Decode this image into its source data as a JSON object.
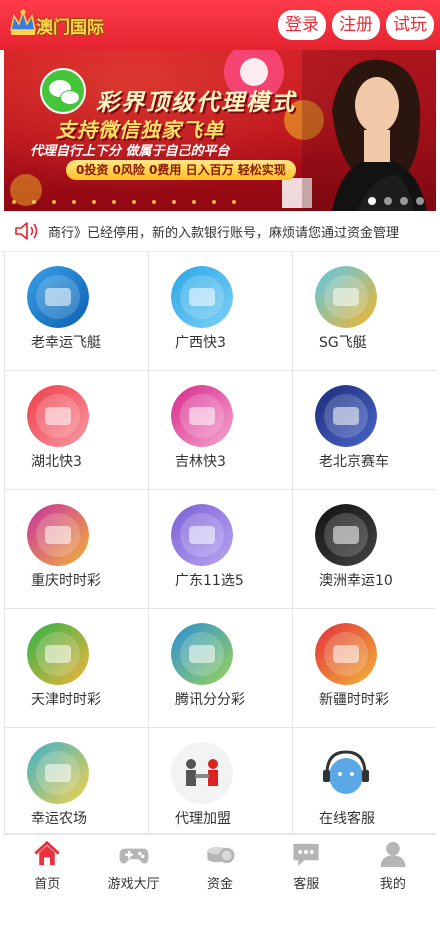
{
  "header": {
    "logo_text": "澳门国际",
    "auth_buttons": [
      "登录",
      "注册",
      "试玩"
    ]
  },
  "banner": {
    "line1": "彩界顶级代理模式",
    "line2": "支持微信独家飞单",
    "line3": "代理自行上下分 做属于自己的平台",
    "pill": "0投资 0风险 0费用 日入百万 轻松实现",
    "slide_count": 4,
    "active_slide": 1
  },
  "notice": {
    "icon": "speaker-icon",
    "text": "商行》已经停用，新的入款银行账号，麻烦请您通过资金管理"
  },
  "games": [
    {
      "label": "老幸运飞艇",
      "icon": "boat-icon",
      "colors": [
        "#3aa0e8",
        "#0b5fb0"
      ]
    },
    {
      "label": "广西快3",
      "icon": "kuai3-icon",
      "colors": [
        "#2aa7e8",
        "#7fd0f5"
      ]
    },
    {
      "label": "SG飞艇",
      "icon": "jetski-icon",
      "colors": [
        "#5cc7ea",
        "#f2b52a"
      ]
    },
    {
      "label": "湖北快3",
      "icon": "kuai3-icon",
      "colors": [
        "#ef3c4a",
        "#f79aa2"
      ]
    },
    {
      "label": "吉林快3",
      "icon": "kuai3-icon",
      "colors": [
        "#d8288b",
        "#f4a7cf"
      ]
    },
    {
      "label": "老北京赛车",
      "icon": "racecar-icon",
      "colors": [
        "#1b2c7a",
        "#4b66c9"
      ]
    },
    {
      "label": "重庆时时彩",
      "icon": "ssc-icon",
      "colors": [
        "#c7309e",
        "#f2b43b"
      ]
    },
    {
      "label": "广东11选5",
      "icon": "11x5-icon",
      "colors": [
        "#7a5fd6",
        "#b9a6f2"
      ]
    },
    {
      "label": "澳洲幸运10",
      "icon": "lucky10-icon",
      "colors": [
        "#111111",
        "#444444"
      ]
    },
    {
      "label": "天津时时彩",
      "icon": "ssc-icon",
      "colors": [
        "#2fb34a",
        "#f2b43b"
      ]
    },
    {
      "label": "腾讯分分彩",
      "icon": "tencent-icon",
      "colors": [
        "#2b8fd6",
        "#9bd35a"
      ]
    },
    {
      "label": "新疆时时彩",
      "icon": "ssc-icon",
      "colors": [
        "#e2303a",
        "#f2b43b"
      ]
    },
    {
      "label": "幸运农场",
      "icon": "farm-icon",
      "colors": [
        "#3cb1c9",
        "#f5d14a"
      ]
    },
    {
      "label": "代理加盟",
      "icon": "handshake-icon",
      "colors": [
        "#eeeeee",
        "#dddddd"
      ]
    },
    {
      "label": "在线客服",
      "icon": "headset-icon",
      "colors": [
        "#ffffff",
        "#5aa9e6"
      ]
    }
  ],
  "tabbar": [
    {
      "label": "首页",
      "icon": "home-icon",
      "active": true
    },
    {
      "label": "游戏大厅",
      "icon": "gamepad-icon",
      "active": false
    },
    {
      "label": "资金",
      "icon": "coins-icon",
      "active": false
    },
    {
      "label": "客服",
      "icon": "chat-icon",
      "active": false
    },
    {
      "label": "我的",
      "icon": "user-icon",
      "active": false
    }
  ],
  "colors": {
    "brand_red": "#e5232f",
    "tab_active": "#e8323e",
    "tab_inactive": "#b5b5b5"
  }
}
